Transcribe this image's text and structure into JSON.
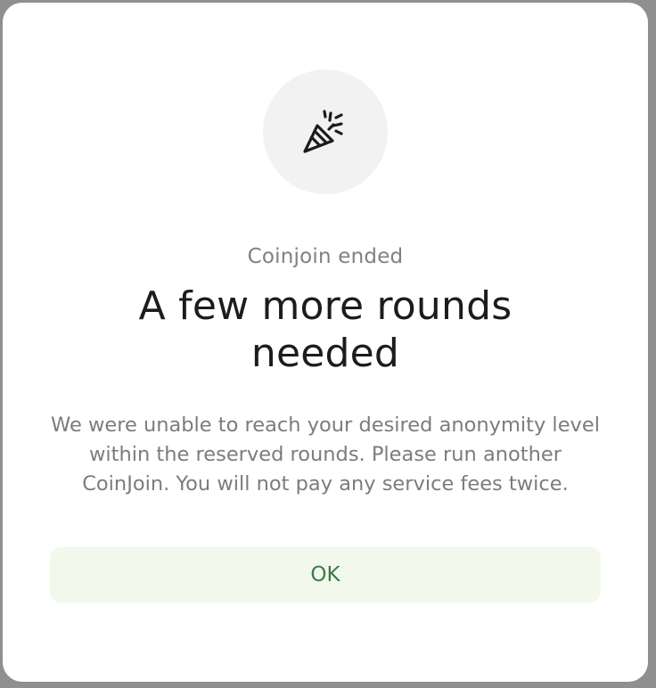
{
  "dialog": {
    "icon": "party-popper-icon",
    "subtitle": "Coinjoin ended",
    "title": "A few more rounds needed",
    "description": "We were unable to reach your desired anonymity level within the reserved rounds. Please run another CoinJoin. You will not pay any service fees twice.",
    "ok_label": "OK"
  },
  "colors": {
    "title": "#1c1c1c",
    "text_muted": "#808080",
    "button_bg": "#f2f8ec",
    "button_text": "#3c7a46",
    "icon_bg": "#f2f2f2"
  }
}
